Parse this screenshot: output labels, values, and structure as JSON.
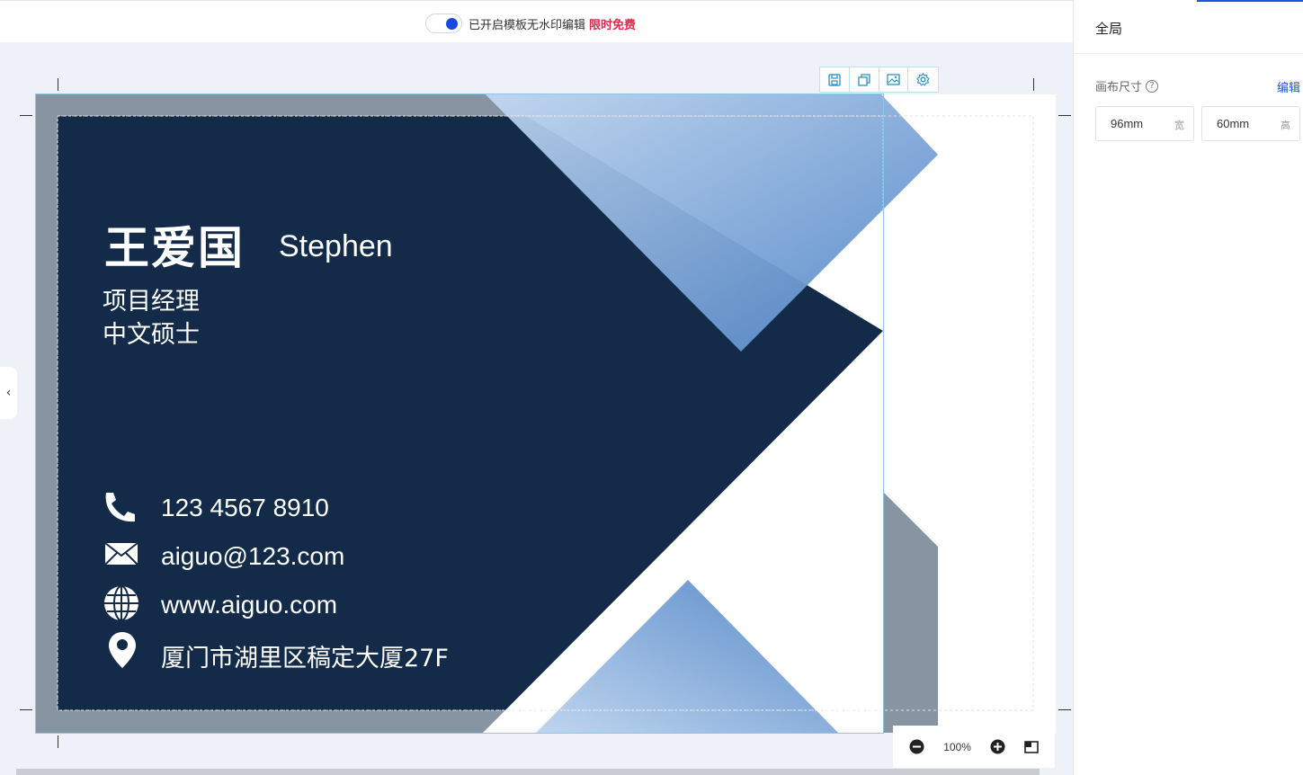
{
  "topbar": {
    "watermark_text": "已开启模板无水印编辑",
    "watermark_free": "限时免费",
    "toggle_state": "on"
  },
  "card": {
    "name_cn": "王爱国",
    "name_en": "Stephen",
    "title_line1": "项目经理",
    "title_line2": "中文硕士",
    "phone": "123 4567 8910",
    "email": "aiguo@123.com",
    "website": "www.aiguo.com",
    "address": "厦门市湖里区稿定大厦27F",
    "colors": {
      "navy": "#132b49",
      "gray": "#8794a1",
      "blue_light": "#bcd3ee",
      "blue_dark": "#5488c8"
    }
  },
  "toolbox": {
    "icons": [
      "save-icon",
      "copy-icon",
      "image-icon",
      "gear-icon"
    ]
  },
  "zoom": {
    "value": "100%"
  },
  "panel": {
    "title": "全局",
    "canvas_size_label": "画布尺寸",
    "help_glyph": "?",
    "edit_link": "编辑",
    "width_value": "96mm",
    "width_unit": "宽",
    "height_value": "60mm",
    "height_unit": "高"
  },
  "sidebar_toggle": "‹"
}
